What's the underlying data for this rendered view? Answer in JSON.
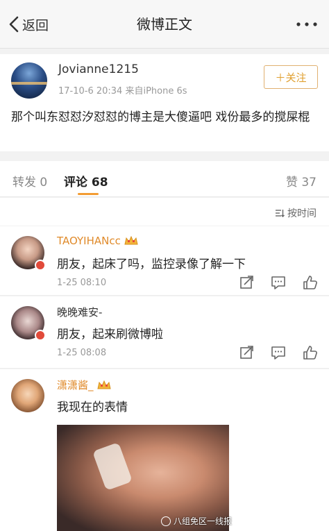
{
  "nav": {
    "back_label": "返回",
    "title": "微博正文"
  },
  "post": {
    "username": "Jovianne1215",
    "meta": "17-10-6 20:34  来自iPhone 6s",
    "follow_label": "＋关注",
    "text": "那个叫东怼怼汐怼怼的博主是大傻逼吧   戏份最多的搅屎棍"
  },
  "tabs": {
    "repost": "转发 0",
    "comment": "评论 68",
    "like": "赞 37"
  },
  "sort": {
    "label": "按时间"
  },
  "comments": [
    {
      "name": "TAOYIHANcc",
      "text": "朋友，起床了吗，监控录像了解一下",
      "time": "1-25 08:10"
    },
    {
      "name": "晚晚难安-",
      "text": "朋友，起来刷微博啦",
      "time": "1-25 08:08"
    },
    {
      "name": "潇潇酱_",
      "text": "我现在的表情",
      "watermark": "八组免区一线报"
    }
  ],
  "colors": {
    "accent": "#f39c33",
    "name_vip": "#e08a2a",
    "badge": "#e14a3a"
  }
}
